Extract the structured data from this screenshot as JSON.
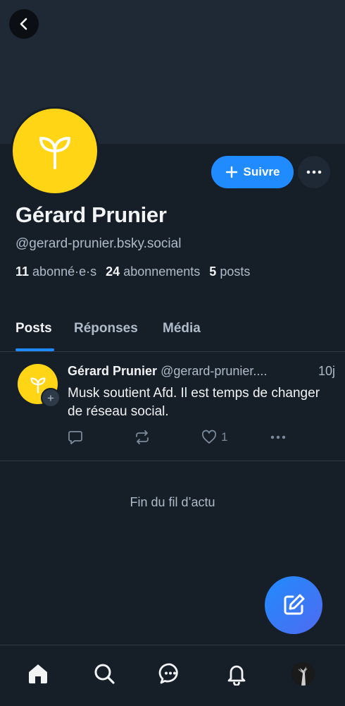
{
  "header": {
    "back_icon": "chevron-left-icon"
  },
  "profile": {
    "display_name": "Gérard Prunier",
    "handle": "@gerard-prunier.bsky.social",
    "avatar_icon": "sprout-icon",
    "avatar_color": "#ffd516",
    "follow_label": "Suivre",
    "stats": {
      "followers_count": "11",
      "followers_label": "abonné·e·s",
      "following_count": "24",
      "following_label": "abonnements",
      "posts_count": "5",
      "posts_label": "posts"
    }
  },
  "tabs": [
    {
      "label": "Posts",
      "active": true
    },
    {
      "label": "Réponses",
      "active": false
    },
    {
      "label": "Média",
      "active": false
    }
  ],
  "post": {
    "author": "Gérard Prunier",
    "handle": "@gerard-prunier....",
    "time": "10j",
    "text": "Musk soutient Afd. Il est temps de changer de réseau social.",
    "likes": "1"
  },
  "feed_end": "Fin du fil d’actu",
  "nav": [
    "home-icon",
    "search-icon",
    "chat-icon",
    "bell-icon",
    "profile-avatar"
  ],
  "colors": {
    "accent": "#208bfe",
    "background": "#161e27",
    "banner": "#1e2935"
  }
}
